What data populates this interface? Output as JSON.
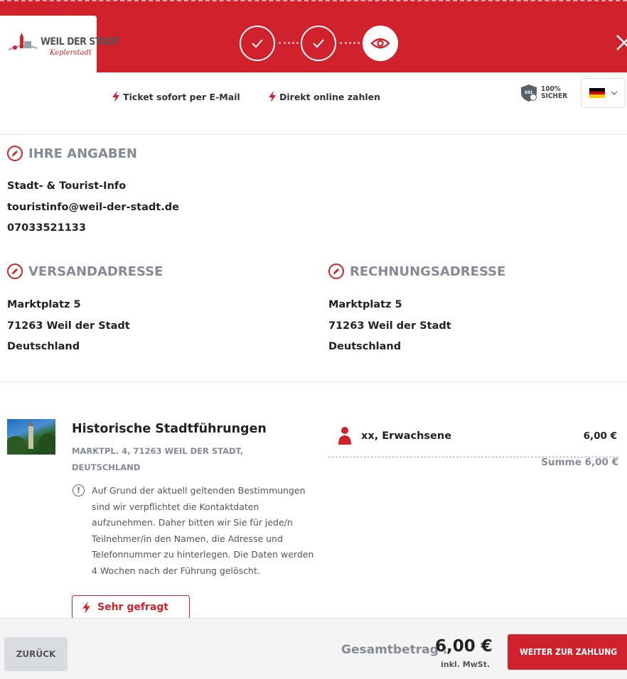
{
  "header": {
    "logo_main": "WEIL DER STADT",
    "logo_sub": "Keplerstadt",
    "steps": [
      {
        "state": "done",
        "icon": "check-icon"
      },
      {
        "state": "done",
        "icon": "check-icon"
      },
      {
        "state": "active",
        "icon": "eye-icon"
      }
    ],
    "close_icon": "close-icon"
  },
  "features": {
    "ticket": "Ticket sofort per E-Mail",
    "pay": "Direkt online zahlen"
  },
  "badges": {
    "ssl_label": "SSL",
    "secure_line1": "100%",
    "secure_line2": "SICHER"
  },
  "language": {
    "selected_flag": "de-flag"
  },
  "customer": {
    "heading": "IHRE ANGABEN",
    "name": "Stadt- & Tourist-Info",
    "email": "touristinfo@weil-der-stadt.de",
    "phone": "07033521133"
  },
  "shipping": {
    "heading": "VERSANDADRESSE",
    "street": "Marktplatz 5",
    "city": "71263 Weil der Stadt",
    "country": "Deutschland"
  },
  "billing": {
    "heading": "RECHNUNGSADRESSE",
    "street": "Marktplatz 5",
    "city": "71263 Weil der Stadt",
    "country": "Deutschland"
  },
  "product": {
    "title": "Historische Stadtführungen",
    "address": "MARKTPL. 4, 71263 WEIL DER STADT, DEUTSCHLAND",
    "note": "Auf Grund der aktuell geltenden Bestimmungen sind wir verpflichtet die Kontaktdaten aufzunehmen. Daher bitten wir Sie für jede/n Teilnehmer/in den Namen, die Adresse und Telefonnummer zu hinterlegen. Die Daten werden 4 Wochen nach der Führung gelöscht.",
    "badge": "Sehr gefragt"
  },
  "order": {
    "item_label": "xx, Erwachsene",
    "item_price": "6,00 €",
    "sum_label": "Summe",
    "sum_value": "6,00 €"
  },
  "footer": {
    "back_label": "ZURÜCK",
    "total_label": "Gesamtbetrag :",
    "total_value": "6,00 €",
    "tax_note": "inkl. MwSt.",
    "pay_label": "WEITER ZUR ZAHLUNG"
  },
  "colors": {
    "brand_red": "#d0222c",
    "muted_gray": "#848b96"
  }
}
